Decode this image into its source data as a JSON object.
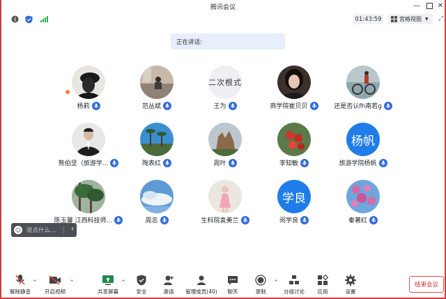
{
  "window": {
    "title": "腾讯会议",
    "controls": [
      "minimize",
      "maximize",
      "close"
    ]
  },
  "infobar": {
    "timer": "01:43:59",
    "view_label": "宫格视图",
    "icons": [
      "info-icon",
      "shield-icon",
      "signal-icon"
    ]
  },
  "speaking": {
    "label": "正在讲话:"
  },
  "participants": [
    {
      "name": "杨莉",
      "avatar": "photo-dark-portrait"
    },
    {
      "name": "范丛斌",
      "avatar": "photo-person-sitting"
    },
    {
      "name": "王为",
      "avatar": "text",
      "avatar_text": "二次根式"
    },
    {
      "name": "商学院崔贝贝",
      "avatar": "photo-woman-portrait"
    },
    {
      "name": "还是否认fh南若g",
      "avatar": "photo-cyclist"
    },
    {
      "name": "熊伯坚（旅游学...",
      "avatar": "photo-man-suit"
    },
    {
      "name": "陶表红",
      "avatar": "photo-palm-trees"
    },
    {
      "name": "周叶",
      "avatar": "photo-rock-formation"
    },
    {
      "name": "李知敏",
      "avatar": "photo-red-berries"
    },
    {
      "name": "旅游学院杨帆",
      "avatar": "text",
      "avatar_text": "杨帆"
    },
    {
      "name": "陈玉馨 江西科技师...",
      "avatar": "photo-forest"
    },
    {
      "name": "周志",
      "avatar": "photo-sky-clouds"
    },
    {
      "name": "生科院袁美兰",
      "avatar": "photo-child-pink"
    },
    {
      "name": "闵学良",
      "avatar": "text",
      "avatar_text": "学良"
    },
    {
      "name": "秦著红",
      "avatar": "photo-pink-blossoms"
    }
  ],
  "chat": {
    "placeholder": "说点什么..."
  },
  "toolbar": {
    "unmute": "解除静音",
    "video": "开启视频",
    "share": "共享屏幕",
    "security": "安全",
    "invite": "邀请",
    "members": "管理成员(40)",
    "chat": "聊天",
    "record": "录制",
    "breakout": "分组讨论",
    "apps": "应用",
    "settings": "设置",
    "end": "结束会议"
  },
  "colors": {
    "accent": "#2f6bd9",
    "end_red": "#d93030",
    "frame_red": "#d23b3b",
    "speaking_bg": "#e7eefc"
  }
}
